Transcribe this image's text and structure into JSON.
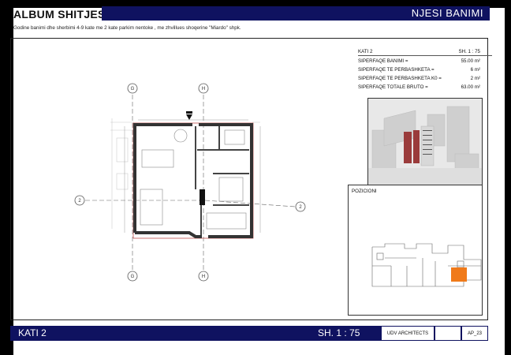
{
  "header": {
    "album_title": "ALBUM SHITJESH",
    "section_title": "NJESI BANIMI",
    "subtitle": "Godine banimi dhe sherbimi 4-9 kate me 2 kate parkim nentoke , me zhvillues shoqerine \"Miardo\" shpk."
  },
  "info": {
    "floor": "KATI 2",
    "sheet_scale": "SH. 1 : 75",
    "rows": [
      {
        "label": "SIPERFAQE BANIMI =",
        "value": "55.00 m²"
      },
      {
        "label": "SIPERFAQE TE PERBASHKETA =",
        "value": "6 m²"
      },
      {
        "label": "SIPERFAQE TE PERBASHKETA K0 =",
        "value": "2 m²"
      },
      {
        "label": "SIPERFAQE TOTALE BRUTO =",
        "value": "63.00 m²"
      }
    ]
  },
  "plan": {
    "axis_labels": {
      "G": "G",
      "H": "H",
      "row": "2"
    }
  },
  "position": {
    "label": "POZICIONI",
    "highlight_color": "#f07a1a"
  },
  "footer": {
    "floor": "KATI 2",
    "scale": "SH. 1 : 75",
    "architect": "UDV ARCHITECTS",
    "sheet_id": "AP_23"
  },
  "colors": {
    "navy": "#0f1260",
    "accent_orange": "#f07a1a"
  }
}
